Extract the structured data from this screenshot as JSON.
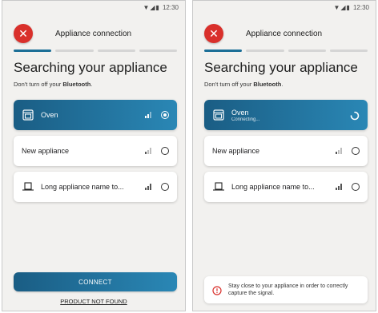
{
  "status_time": "12:30",
  "screens": [
    {
      "header_title": "Appliance connection",
      "title": "Searching your appliance",
      "subtitle_prefix": "Don't turn off your ",
      "subtitle_bold": "Bluetooth",
      "subtitle_suffix": ".",
      "appliances": [
        {
          "name": "Oven",
          "signal_bars_on": 2,
          "state": "selected"
        },
        {
          "name": "New appliance",
          "signal_bars_on": 1,
          "state": "unselected"
        },
        {
          "name": "Long appliance name to...",
          "signal_bars_on": 3,
          "state": "unselected"
        }
      ],
      "connect_label": "CONNECT",
      "not_found_label": "PRODUCT NOT FOUND"
    },
    {
      "header_title": "Appliance connection",
      "title": "Searching your appliance",
      "subtitle_prefix": "Don't turn off your ",
      "subtitle_bold": "Bluetooth",
      "subtitle_suffix": ".",
      "appliances": [
        {
          "name": "Oven",
          "status": "Connecting...",
          "state": "connecting"
        },
        {
          "name": "New appliance",
          "signal_bars_on": 1,
          "state": "unselected"
        },
        {
          "name": "Long appliance name to...",
          "signal_bars_on": 3,
          "state": "unselected"
        }
      ],
      "tip_text": "Stay close to your appliance in order to correctly capture the signal."
    }
  ],
  "colors": {
    "accent": "#1c6f97",
    "close_red": "#d9302b",
    "background": "#f2f1ef"
  }
}
